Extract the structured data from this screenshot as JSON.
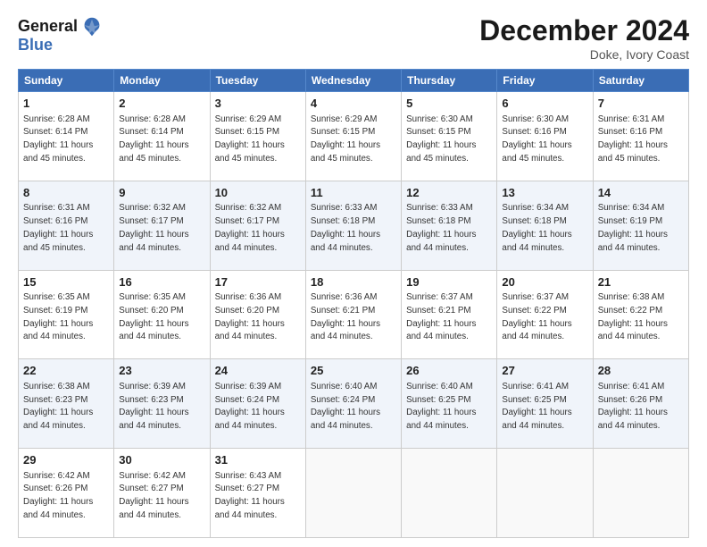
{
  "logo": {
    "line1": "General",
    "line2": "Blue"
  },
  "header": {
    "month": "December 2024",
    "location": "Doke, Ivory Coast"
  },
  "days_of_week": [
    "Sunday",
    "Monday",
    "Tuesday",
    "Wednesday",
    "Thursday",
    "Friday",
    "Saturday"
  ],
  "weeks": [
    [
      {
        "day": "1",
        "sunrise": "6:28 AM",
        "sunset": "6:14 PM",
        "daylight": "11 hours and 45 minutes."
      },
      {
        "day": "2",
        "sunrise": "6:28 AM",
        "sunset": "6:14 PM",
        "daylight": "11 hours and 45 minutes."
      },
      {
        "day": "3",
        "sunrise": "6:29 AM",
        "sunset": "6:15 PM",
        "daylight": "11 hours and 45 minutes."
      },
      {
        "day": "4",
        "sunrise": "6:29 AM",
        "sunset": "6:15 PM",
        "daylight": "11 hours and 45 minutes."
      },
      {
        "day": "5",
        "sunrise": "6:30 AM",
        "sunset": "6:15 PM",
        "daylight": "11 hours and 45 minutes."
      },
      {
        "day": "6",
        "sunrise": "6:30 AM",
        "sunset": "6:16 PM",
        "daylight": "11 hours and 45 minutes."
      },
      {
        "day": "7",
        "sunrise": "6:31 AM",
        "sunset": "6:16 PM",
        "daylight": "11 hours and 45 minutes."
      }
    ],
    [
      {
        "day": "8",
        "sunrise": "6:31 AM",
        "sunset": "6:16 PM",
        "daylight": "11 hours and 45 minutes."
      },
      {
        "day": "9",
        "sunrise": "6:32 AM",
        "sunset": "6:17 PM",
        "daylight": "11 hours and 44 minutes."
      },
      {
        "day": "10",
        "sunrise": "6:32 AM",
        "sunset": "6:17 PM",
        "daylight": "11 hours and 44 minutes."
      },
      {
        "day": "11",
        "sunrise": "6:33 AM",
        "sunset": "6:18 PM",
        "daylight": "11 hours and 44 minutes."
      },
      {
        "day": "12",
        "sunrise": "6:33 AM",
        "sunset": "6:18 PM",
        "daylight": "11 hours and 44 minutes."
      },
      {
        "day": "13",
        "sunrise": "6:34 AM",
        "sunset": "6:18 PM",
        "daylight": "11 hours and 44 minutes."
      },
      {
        "day": "14",
        "sunrise": "6:34 AM",
        "sunset": "6:19 PM",
        "daylight": "11 hours and 44 minutes."
      }
    ],
    [
      {
        "day": "15",
        "sunrise": "6:35 AM",
        "sunset": "6:19 PM",
        "daylight": "11 hours and 44 minutes."
      },
      {
        "day": "16",
        "sunrise": "6:35 AM",
        "sunset": "6:20 PM",
        "daylight": "11 hours and 44 minutes."
      },
      {
        "day": "17",
        "sunrise": "6:36 AM",
        "sunset": "6:20 PM",
        "daylight": "11 hours and 44 minutes."
      },
      {
        "day": "18",
        "sunrise": "6:36 AM",
        "sunset": "6:21 PM",
        "daylight": "11 hours and 44 minutes."
      },
      {
        "day": "19",
        "sunrise": "6:37 AM",
        "sunset": "6:21 PM",
        "daylight": "11 hours and 44 minutes."
      },
      {
        "day": "20",
        "sunrise": "6:37 AM",
        "sunset": "6:22 PM",
        "daylight": "11 hours and 44 minutes."
      },
      {
        "day": "21",
        "sunrise": "6:38 AM",
        "sunset": "6:22 PM",
        "daylight": "11 hours and 44 minutes."
      }
    ],
    [
      {
        "day": "22",
        "sunrise": "6:38 AM",
        "sunset": "6:23 PM",
        "daylight": "11 hours and 44 minutes."
      },
      {
        "day": "23",
        "sunrise": "6:39 AM",
        "sunset": "6:23 PM",
        "daylight": "11 hours and 44 minutes."
      },
      {
        "day": "24",
        "sunrise": "6:39 AM",
        "sunset": "6:24 PM",
        "daylight": "11 hours and 44 minutes."
      },
      {
        "day": "25",
        "sunrise": "6:40 AM",
        "sunset": "6:24 PM",
        "daylight": "11 hours and 44 minutes."
      },
      {
        "day": "26",
        "sunrise": "6:40 AM",
        "sunset": "6:25 PM",
        "daylight": "11 hours and 44 minutes."
      },
      {
        "day": "27",
        "sunrise": "6:41 AM",
        "sunset": "6:25 PM",
        "daylight": "11 hours and 44 minutes."
      },
      {
        "day": "28",
        "sunrise": "6:41 AM",
        "sunset": "6:26 PM",
        "daylight": "11 hours and 44 minutes."
      }
    ],
    [
      {
        "day": "29",
        "sunrise": "6:42 AM",
        "sunset": "6:26 PM",
        "daylight": "11 hours and 44 minutes."
      },
      {
        "day": "30",
        "sunrise": "6:42 AM",
        "sunset": "6:27 PM",
        "daylight": "11 hours and 44 minutes."
      },
      {
        "day": "31",
        "sunrise": "6:43 AM",
        "sunset": "6:27 PM",
        "daylight": "11 hours and 44 minutes."
      },
      null,
      null,
      null,
      null
    ]
  ]
}
